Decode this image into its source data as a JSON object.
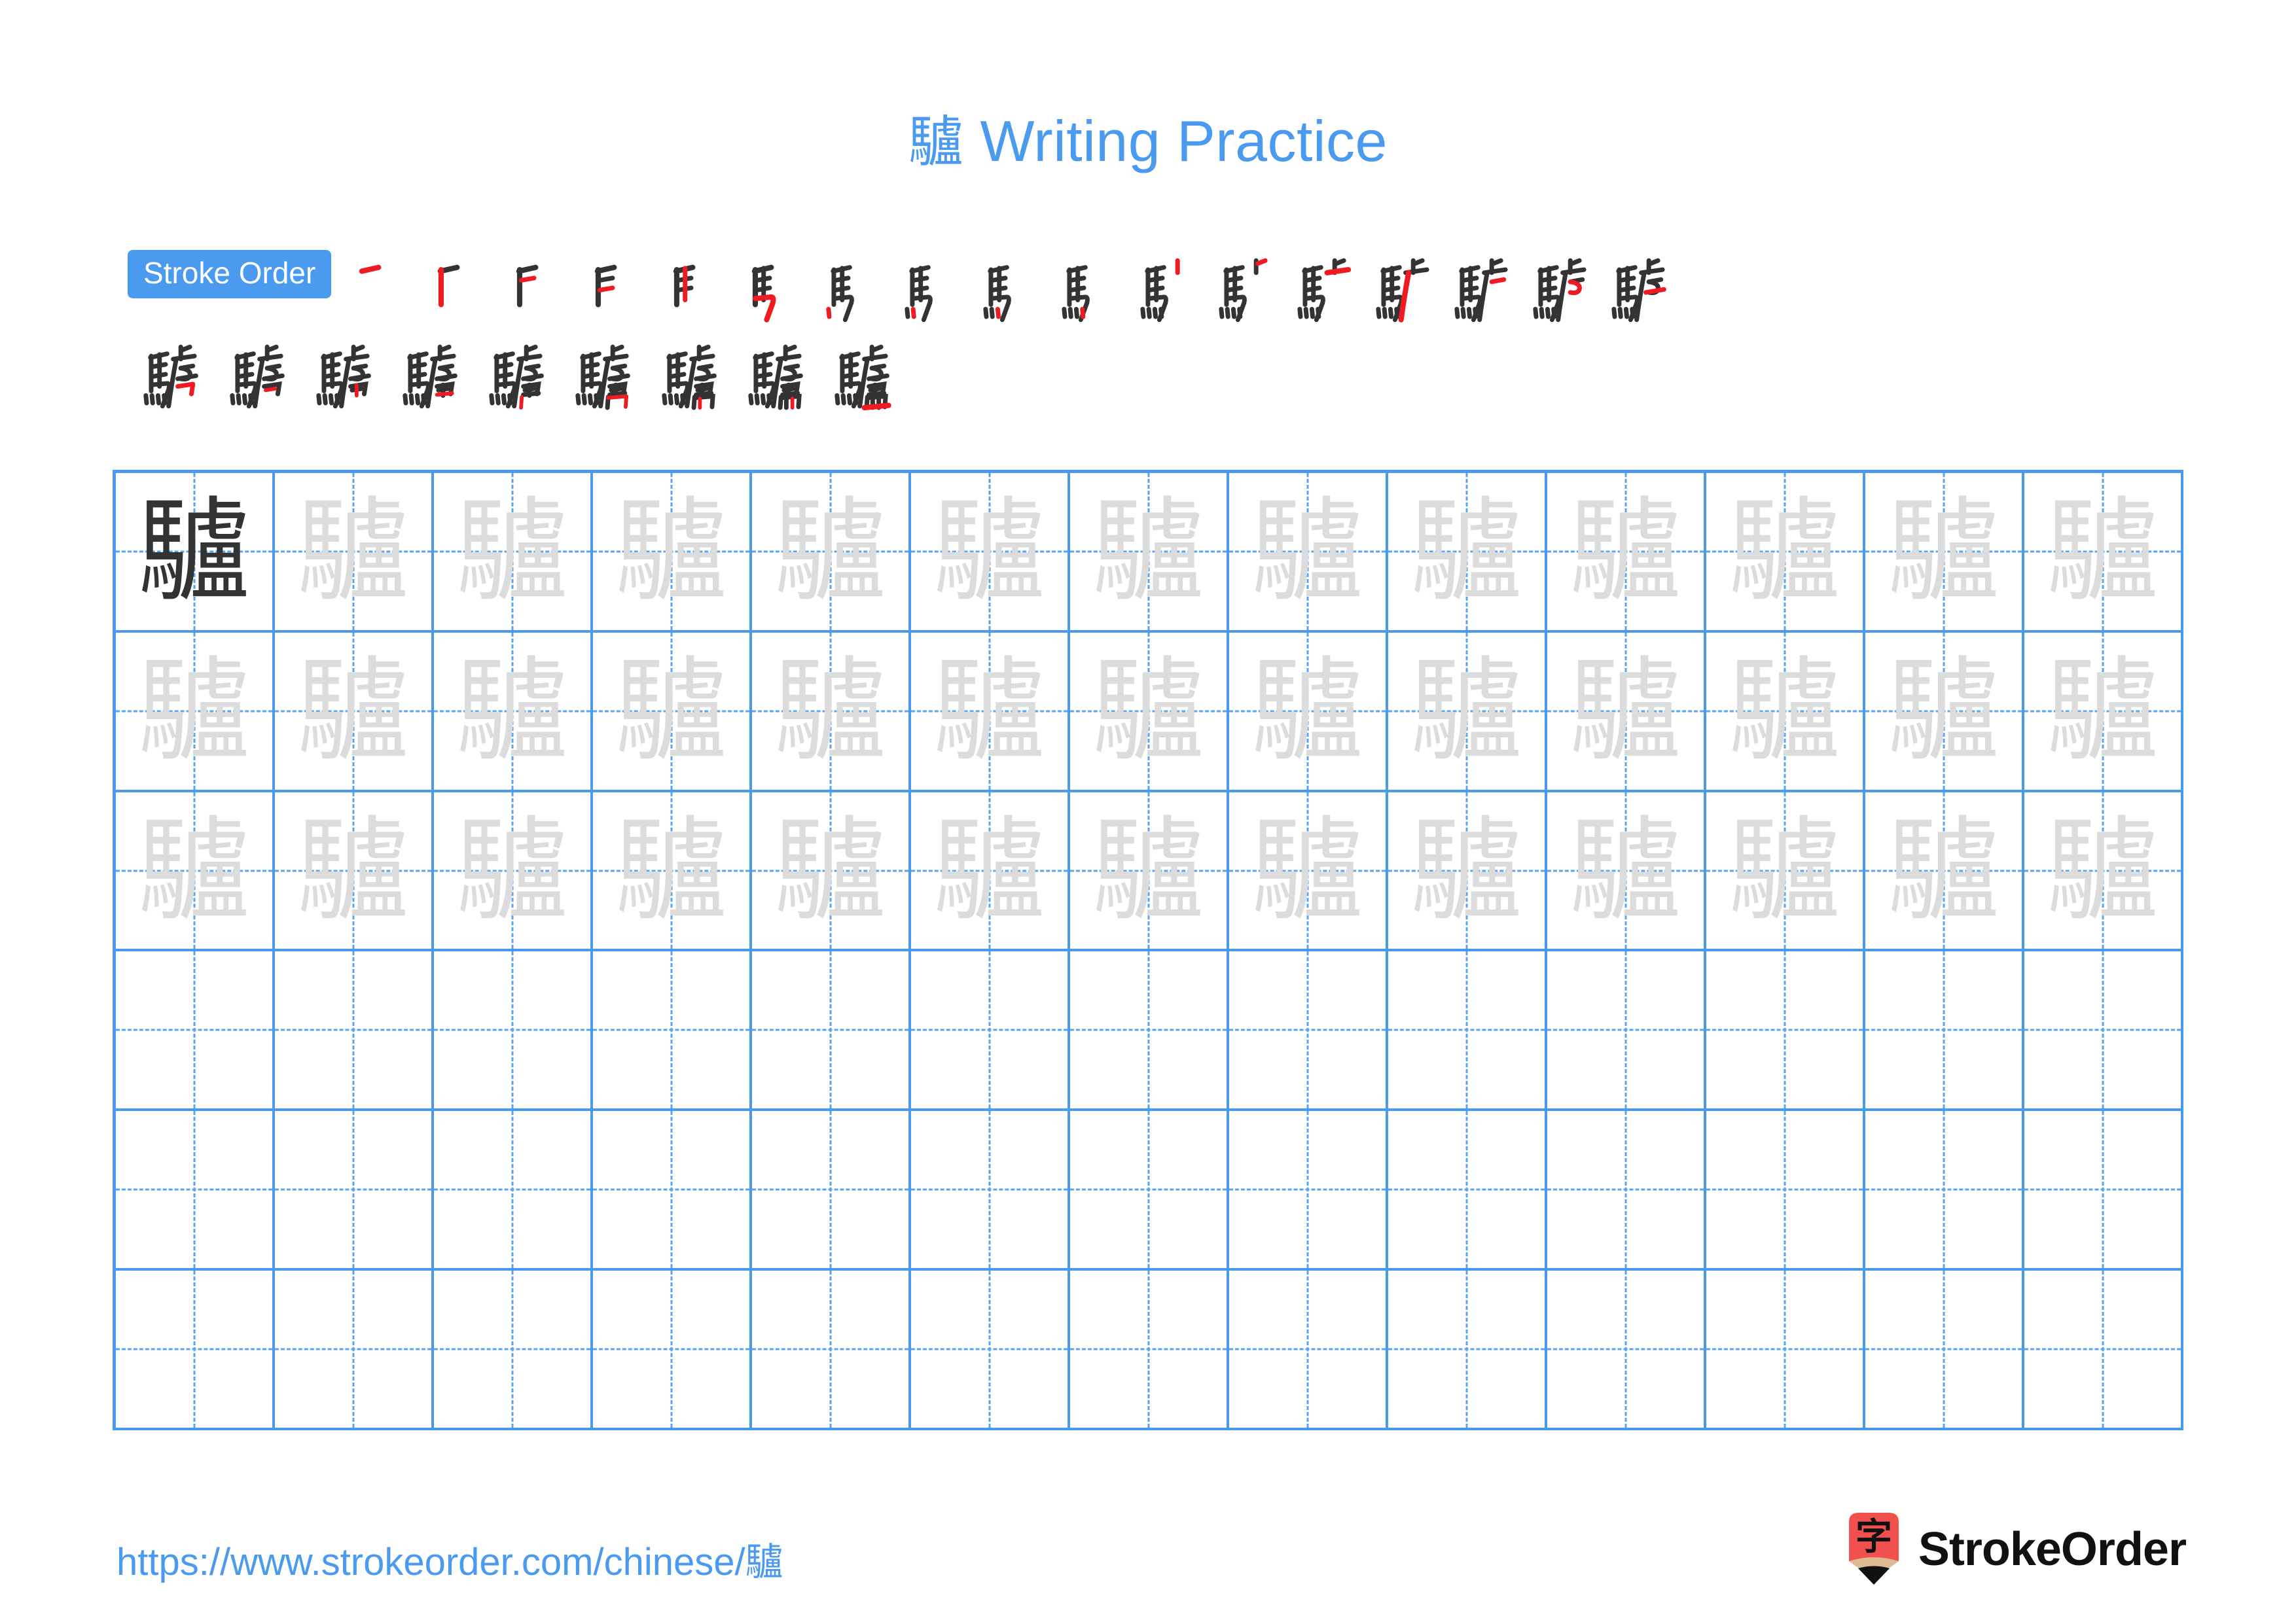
{
  "title": {
    "character": "驢",
    "text": " Writing Practice",
    "color": "#4a9af0"
  },
  "stroke_order": {
    "badge_label": "Stroke Order",
    "badge_bg": "#4a9af0",
    "badge_text_color": "#ffffff",
    "total_strokes": 26,
    "new_stroke_color": "#ee1c22",
    "drawn_stroke_color": "#333333",
    "row1_count": 17,
    "row2_count": 9,
    "steps": [
      {
        "index": 1,
        "glyph": "一"
      },
      {
        "index": 2,
        "glyph": "丨"
      },
      {
        "index": 3,
        "glyph": "一"
      },
      {
        "index": 4,
        "glyph": "一"
      },
      {
        "index": 5,
        "glyph": "丨"
      },
      {
        "index": 6,
        "glyph": "乙"
      },
      {
        "index": 7,
        "glyph": "丶"
      },
      {
        "index": 8,
        "glyph": "丶"
      },
      {
        "index": 9,
        "glyph": "丶"
      },
      {
        "index": 10,
        "glyph": "丶"
      },
      {
        "index": 11,
        "glyph": "丨"
      },
      {
        "index": 12,
        "glyph": "丶"
      },
      {
        "index": 13,
        "glyph": "一"
      },
      {
        "index": 14,
        "glyph": "丿"
      },
      {
        "index": 15,
        "glyph": "一"
      },
      {
        "index": 16,
        "glyph": "乙"
      },
      {
        "index": 17,
        "glyph": "丨"
      },
      {
        "index": 18,
        "glyph": "乛"
      },
      {
        "index": 19,
        "glyph": "一"
      },
      {
        "index": 20,
        "glyph": "丨"
      },
      {
        "index": 21,
        "glyph": "一"
      },
      {
        "index": 22,
        "glyph": "丨"
      },
      {
        "index": 23,
        "glyph": "乛"
      },
      {
        "index": 24,
        "glyph": "丨"
      },
      {
        "index": 25,
        "glyph": "丨"
      },
      {
        "index": 26,
        "glyph": "一"
      }
    ]
  },
  "practice_grid": {
    "columns": 13,
    "rows": 6,
    "border_color": "#4a9af0",
    "guide_color": "#58a6f2",
    "dark_char_color": "#333333",
    "light_char_color": "#dcdcdc",
    "character": "驢",
    "filled_rows": 3,
    "empty_rows": 3,
    "dark_cell": {
      "row": 1,
      "col": 1
    }
  },
  "footer": {
    "url": "https://www.strokeorder.com/chinese/驢",
    "url_color": "#4a9af0",
    "logo": {
      "wordmark": "StrokeOrder",
      "badge_char": "字",
      "pencil_body_color": "#f0514f",
      "pencil_wood_color": "#ddbb92",
      "pencil_tip_color": "#111111"
    }
  }
}
